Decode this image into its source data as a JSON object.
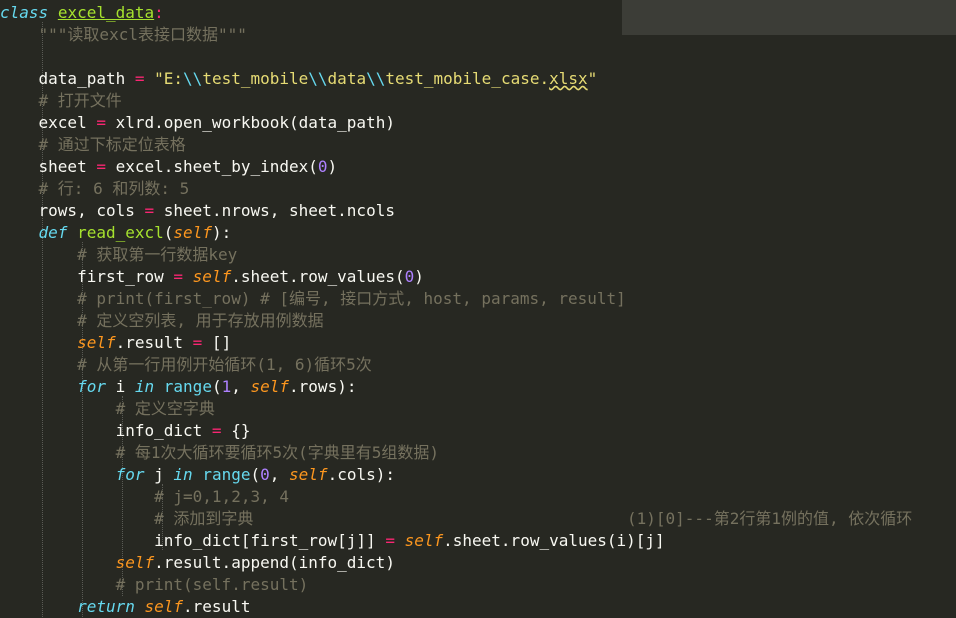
{
  "lines": [
    [
      {
        "t": "class",
        "c": "kw"
      },
      {
        "t": " "
      },
      {
        "t": "excel_data",
        "c": "cls"
      },
      {
        "t": ":",
        "c": "op"
      }
    ],
    [
      {
        "t": "    "
      },
      {
        "t": "\"\"\"读取excl表接口数据\"\"\"",
        "c": "cm"
      }
    ],
    [
      {
        "t": ""
      }
    ],
    [
      {
        "t": "    data_path "
      },
      {
        "t": "=",
        "c": "op"
      },
      {
        "t": " "
      },
      {
        "t": "\"E:",
        "c": "str"
      },
      {
        "t": "\\\\",
        "c": "strp"
      },
      {
        "t": "test_mobile",
        "c": "str"
      },
      {
        "t": "\\\\",
        "c": "strp"
      },
      {
        "t": "data",
        "c": "str"
      },
      {
        "t": "\\\\",
        "c": "strp"
      },
      {
        "t": "test_mobile_case.",
        "c": "str"
      },
      {
        "t": "xlsx",
        "c": "str squig"
      },
      {
        "t": "\"",
        "c": "str"
      }
    ],
    [
      {
        "t": "    "
      },
      {
        "t": "# 打开文件",
        "c": "cm"
      }
    ],
    [
      {
        "t": "    excel "
      },
      {
        "t": "=",
        "c": "op"
      },
      {
        "t": " xlrd.open_workbook(data_path)"
      }
    ],
    [
      {
        "t": "    "
      },
      {
        "t": "# 通过下标定位表格",
        "c": "cm"
      }
    ],
    [
      {
        "t": "    sheet "
      },
      {
        "t": "=",
        "c": "op"
      },
      {
        "t": " excel.sheet_by_index("
      },
      {
        "t": "0",
        "c": "num"
      },
      {
        "t": ")"
      }
    ],
    [
      {
        "t": "    "
      },
      {
        "t": "# 行: 6 和列数: 5",
        "c": "cm"
      }
    ],
    [
      {
        "t": "    rows, cols "
      },
      {
        "t": "=",
        "c": "op"
      },
      {
        "t": " sheet.nrows, sheet.ncols"
      }
    ],
    [
      {
        "t": "    "
      },
      {
        "t": "def",
        "c": "kw"
      },
      {
        "t": " "
      },
      {
        "t": "read_excl",
        "c": "fn"
      },
      {
        "t": "("
      },
      {
        "t": "self",
        "c": "self"
      },
      {
        "t": "):"
      }
    ],
    [
      {
        "t": "        "
      },
      {
        "t": "# 获取第一行数据key",
        "c": "cm"
      }
    ],
    [
      {
        "t": "        first_row "
      },
      {
        "t": "=",
        "c": "op"
      },
      {
        "t": " "
      },
      {
        "t": "self",
        "c": "self"
      },
      {
        "t": ".sheet.row_values("
      },
      {
        "t": "0",
        "c": "num"
      },
      {
        "t": ")"
      }
    ],
    [
      {
        "t": "        "
      },
      {
        "t": "# print(first_row) # [编号, 接口方式, host, params, result]",
        "c": "cm"
      }
    ],
    [
      {
        "t": "        "
      },
      {
        "t": "# 定义空列表, 用于存放用例数据",
        "c": "cm"
      }
    ],
    [
      {
        "t": "        "
      },
      {
        "t": "self",
        "c": "self"
      },
      {
        "t": ".result "
      },
      {
        "t": "=",
        "c": "op"
      },
      {
        "t": " []"
      }
    ],
    [
      {
        "t": "        "
      },
      {
        "t": "# 从第一行用例开始循环(1, 6)循环5次",
        "c": "cm"
      }
    ],
    [
      {
        "t": "        "
      },
      {
        "t": "for",
        "c": "kw"
      },
      {
        "t": " i "
      },
      {
        "t": "in",
        "c": "kw"
      },
      {
        "t": " "
      },
      {
        "t": "range",
        "c": "builtin"
      },
      {
        "t": "("
      },
      {
        "t": "1",
        "c": "num"
      },
      {
        "t": ", "
      },
      {
        "t": "self",
        "c": "self"
      },
      {
        "t": ".rows):"
      }
    ],
    [
      {
        "t": "            "
      },
      {
        "t": "# 定义空字典",
        "c": "cm"
      }
    ],
    [
      {
        "t": "            info_dict "
      },
      {
        "t": "=",
        "c": "op"
      },
      {
        "t": " {}"
      }
    ],
    [
      {
        "t": "            "
      },
      {
        "t": "# 每1次大循环要循环5次(字典里有5组数据)",
        "c": "cm"
      }
    ],
    [
      {
        "t": "            "
      },
      {
        "t": "for",
        "c": "kw"
      },
      {
        "t": " j "
      },
      {
        "t": "in",
        "c": "kw"
      },
      {
        "t": " "
      },
      {
        "t": "range",
        "c": "builtin"
      },
      {
        "t": "("
      },
      {
        "t": "0",
        "c": "num"
      },
      {
        "t": ", "
      },
      {
        "t": "self",
        "c": "self"
      },
      {
        "t": ".cols):"
      }
    ],
    [
      {
        "t": "                "
      },
      {
        "t": "# j=0,1,2,3, 4",
        "c": "cm"
      }
    ],
    [
      {
        "t": "                "
      },
      {
        "t": "# 添加到字典",
        "c": "cm"
      }
    ],
    [
      {
        "t": "                info_dict[first_row[j]] "
      },
      {
        "t": "=",
        "c": "op"
      },
      {
        "t": " "
      },
      {
        "t": "self",
        "c": "self"
      },
      {
        "t": ".sheet.row_values(i)[j]"
      }
    ],
    [
      {
        "t": "            "
      },
      {
        "t": "self",
        "c": "self"
      },
      {
        "t": ".result.append(info_dict)"
      }
    ],
    [
      {
        "t": "            "
      },
      {
        "t": "# print(self.result)",
        "c": "cm"
      }
    ],
    [
      {
        "t": "        "
      },
      {
        "t": "return",
        "c": "kw"
      },
      {
        "t": " "
      },
      {
        "t": "self",
        "c": "self"
      },
      {
        "t": ".result"
      }
    ]
  ],
  "trailing_comment": "(1)[0]---第2行第1例的值, 依次循环"
}
